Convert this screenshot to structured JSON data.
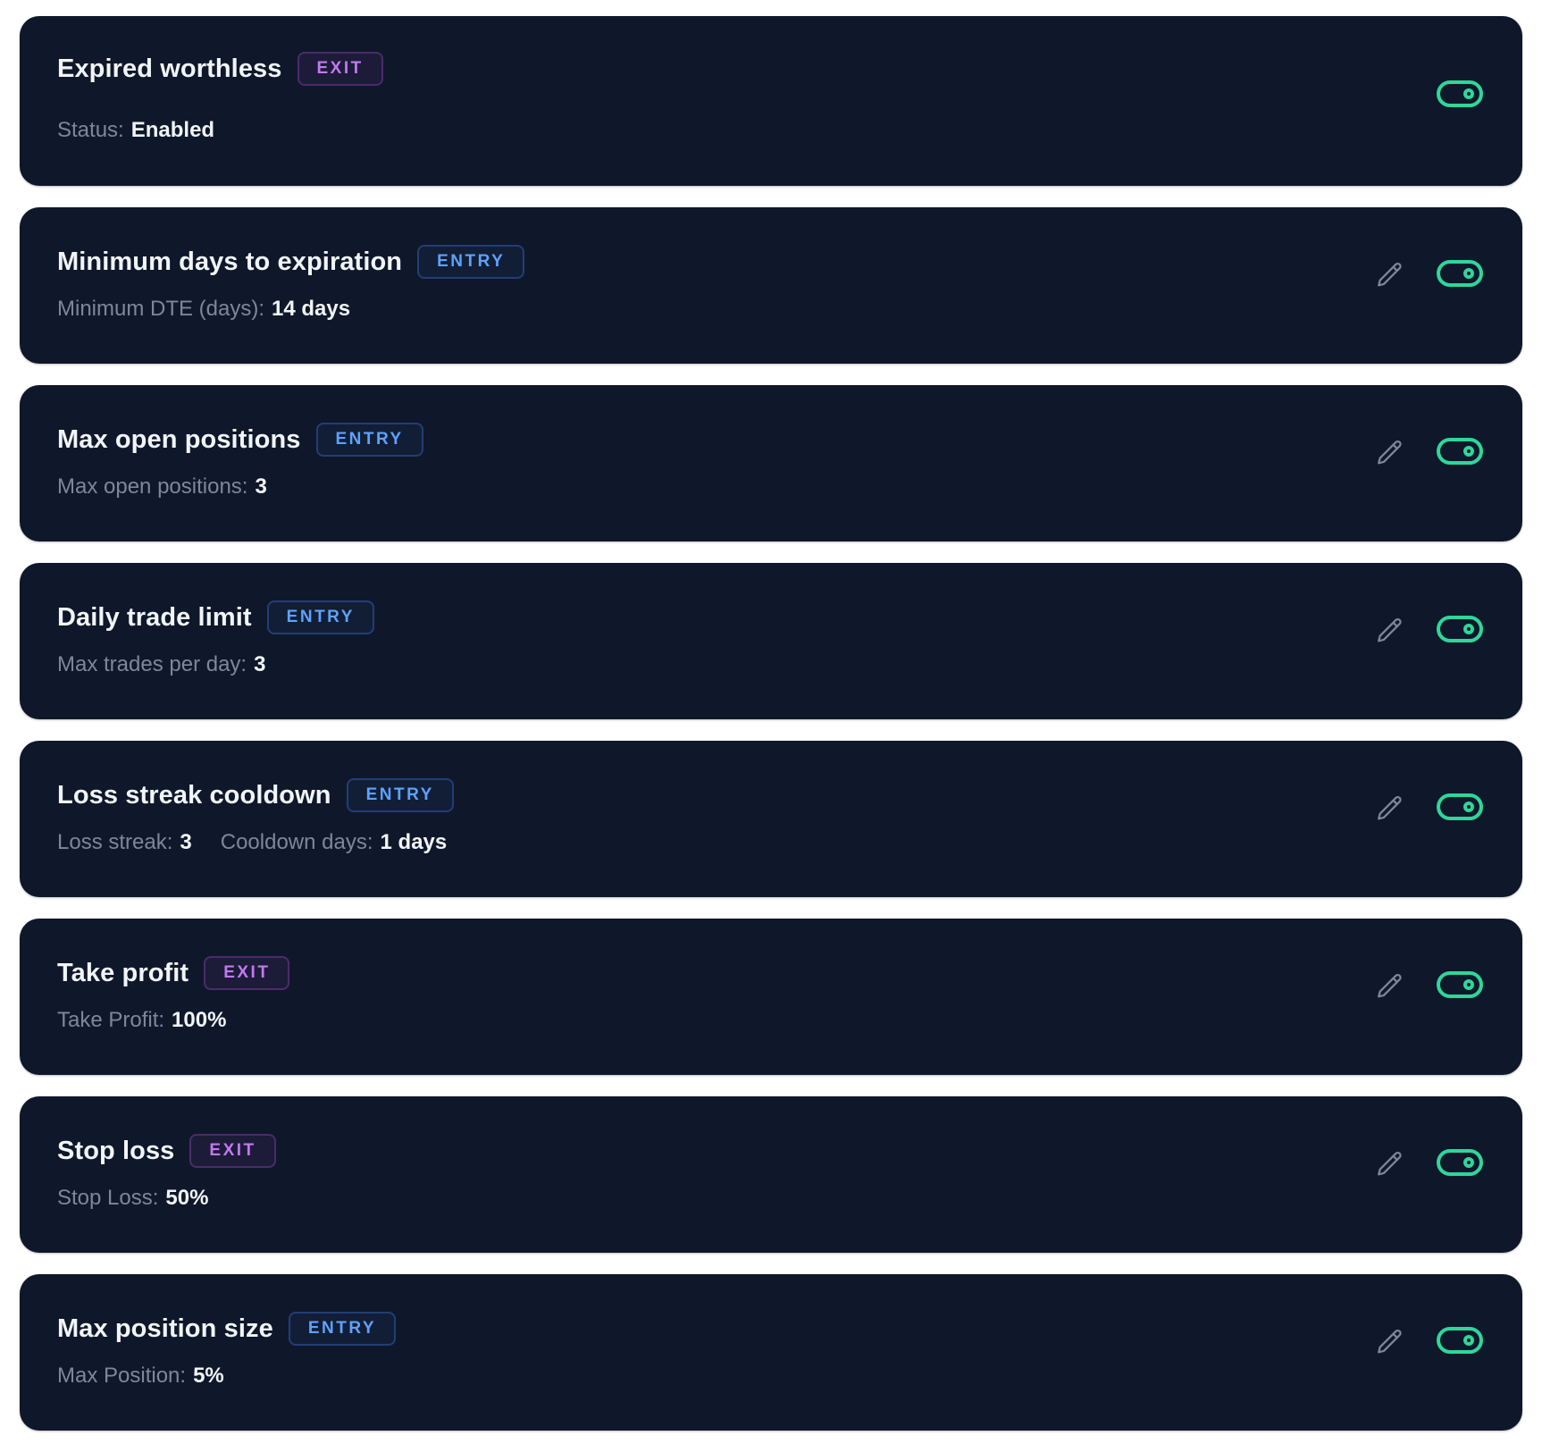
{
  "colors": {
    "card_bg": "#0f182a",
    "entry_badge": "#5ea2ff",
    "exit_badge": "#c478f2",
    "toggle_on": "#2fd69a",
    "label": "#7c889a",
    "value": "#f1f5f9"
  },
  "rules": [
    {
      "title": "Expired worthless",
      "badge": "EXIT",
      "badge_type": "exit",
      "editable": false,
      "enabled": true,
      "details": [
        {
          "label": "Status:",
          "value": "Enabled"
        }
      ]
    },
    {
      "title": "Minimum days to expiration",
      "badge": "ENTRY",
      "badge_type": "entry",
      "editable": true,
      "enabled": true,
      "details": [
        {
          "label": "Minimum DTE (days):",
          "value": "14 days"
        }
      ]
    },
    {
      "title": "Max open positions",
      "badge": "ENTRY",
      "badge_type": "entry",
      "editable": true,
      "enabled": true,
      "details": [
        {
          "label": "Max open positions:",
          "value": "3"
        }
      ]
    },
    {
      "title": "Daily trade limit",
      "badge": "ENTRY",
      "badge_type": "entry",
      "editable": true,
      "enabled": true,
      "details": [
        {
          "label": "Max trades per day:",
          "value": "3"
        }
      ]
    },
    {
      "title": "Loss streak cooldown",
      "badge": "ENTRY",
      "badge_type": "entry",
      "editable": true,
      "enabled": true,
      "details": [
        {
          "label": "Loss streak:",
          "value": "3"
        },
        {
          "label": "Cooldown days:",
          "value": "1 days"
        }
      ]
    },
    {
      "title": "Take profit",
      "badge": "EXIT",
      "badge_type": "exit",
      "editable": true,
      "enabled": true,
      "details": [
        {
          "label": "Take Profit:",
          "value": "100%"
        }
      ]
    },
    {
      "title": "Stop loss",
      "badge": "EXIT",
      "badge_type": "exit",
      "editable": true,
      "enabled": true,
      "details": [
        {
          "label": "Stop Loss:",
          "value": "50%"
        }
      ]
    },
    {
      "title": "Max position size",
      "badge": "ENTRY",
      "badge_type": "entry",
      "editable": true,
      "enabled": true,
      "details": [
        {
          "label": "Max Position:",
          "value": "5%"
        }
      ]
    }
  ]
}
